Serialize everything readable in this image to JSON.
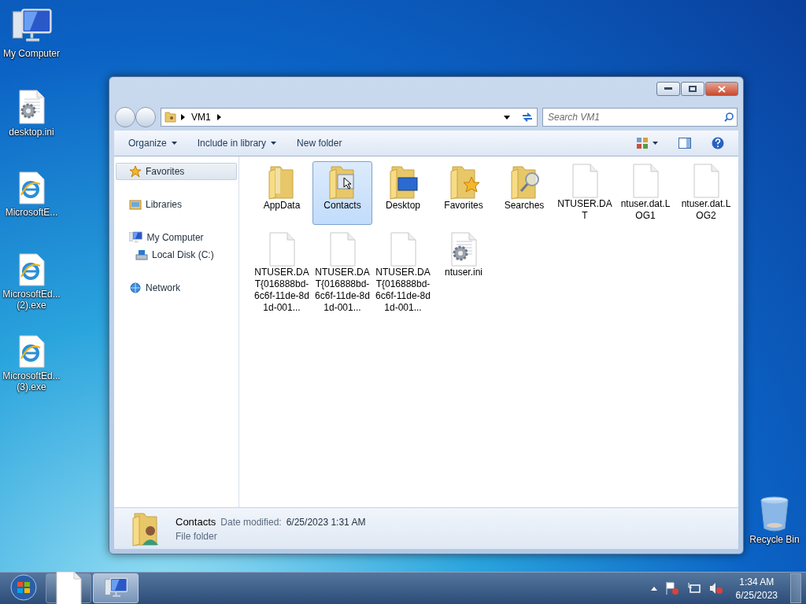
{
  "desktop_icons": [
    {
      "kind": "computer",
      "label": "My Computer"
    },
    {
      "kind": "settings",
      "label": "desktop.ini"
    },
    {
      "kind": "ie",
      "label": "MicrosoftE..."
    },
    {
      "kind": "ie",
      "label": "MicrosoftEd... (2).exe"
    },
    {
      "kind": "ie",
      "label": "MicrosoftEd... (3).exe"
    }
  ],
  "recycle_bin": {
    "label": "Recycle Bin"
  },
  "window": {
    "address": [
      "VM1"
    ],
    "search": {
      "placeholder": "Search VM1"
    },
    "toolbar": [
      {
        "label": "Organize",
        "dropdown": true
      },
      {
        "label": "Include in library",
        "dropdown": true
      },
      {
        "label": "New folder",
        "dropdown": false
      }
    ],
    "nav": [
      {
        "label": "Favorites",
        "kind": "star",
        "selected": true
      },
      {
        "label": "Libraries",
        "kind": "library",
        "selected": false
      },
      {
        "label": "My Computer",
        "kind": "computer",
        "selected": false,
        "children": [
          {
            "label": "Local Disk (C:)",
            "kind": "disk",
            "selected": false
          }
        ]
      },
      {
        "label": "Network",
        "kind": "network",
        "selected": false
      }
    ],
    "files": [
      {
        "name": "AppData",
        "kind": "folder",
        "selected": false
      },
      {
        "name": "Contacts",
        "kind": "contacts",
        "selected": true
      },
      {
        "name": "Desktop",
        "kind": "desktop",
        "selected": false
      },
      {
        "name": "Favorites",
        "kind": "favorites",
        "selected": false
      },
      {
        "name": "Searches",
        "kind": "searches",
        "selected": false
      },
      {
        "name": "NTUSER.DAT",
        "kind": "file",
        "selected": false
      },
      {
        "name": "ntuser.dat.LOG1",
        "kind": "file",
        "selected": false
      },
      {
        "name": "ntuser.dat.LOG2",
        "kind": "file",
        "selected": false
      },
      {
        "name": "NTUSER.DAT{016888bd-6c6f-11de-8d1d-001...",
        "kind": "file",
        "selected": false
      },
      {
        "name": "NTUSER.DAT{016888bd-6c6f-11de-8d1d-001...",
        "kind": "file",
        "selected": false
      },
      {
        "name": "NTUSER.DAT{016888bd-6c6f-11de-8d1d-001...",
        "kind": "file",
        "selected": false
      },
      {
        "name": "ntuser.ini",
        "kind": "settings",
        "selected": false
      }
    ],
    "details": {
      "name": "Contacts",
      "date_label": "Date modified:",
      "date": "6/25/2023 1:31 AM",
      "type": "File folder"
    }
  },
  "taskbar": {
    "buttons": [
      {
        "kind": "document",
        "selected": false
      },
      {
        "kind": "computer",
        "selected": true
      }
    ],
    "time": "1:34 AM",
    "date": "6/25/2023"
  }
}
